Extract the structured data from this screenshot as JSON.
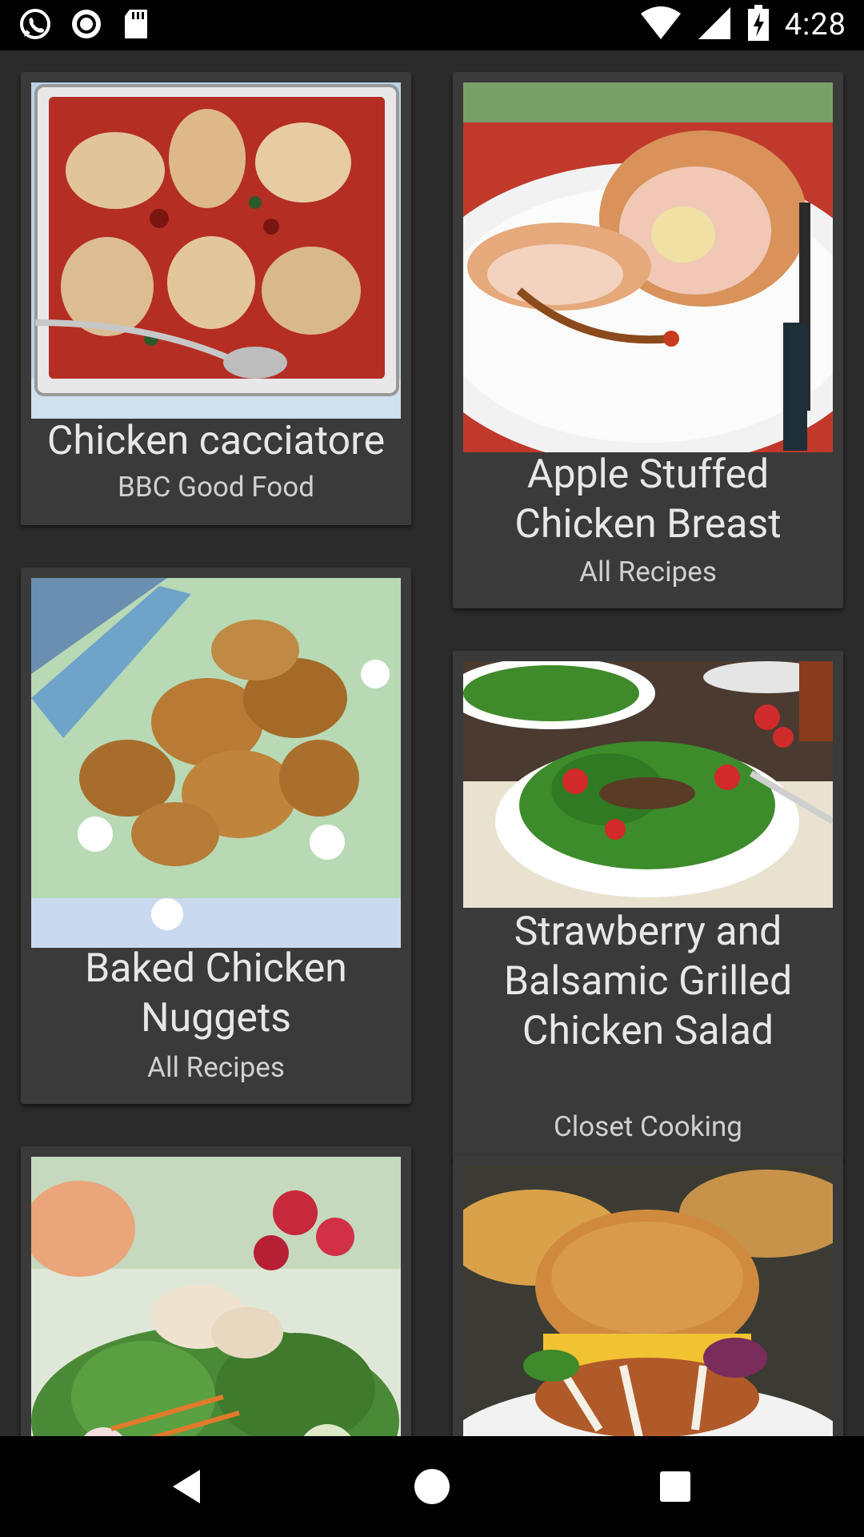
{
  "status_bar": {
    "time": "4:28",
    "icons": [
      "whatsapp-icon",
      "record-icon",
      "sd-card-icon",
      "wifi-icon",
      "signal-icon",
      "battery-charging-icon"
    ]
  },
  "recipes": [
    {
      "title": "Chicken cacciatore",
      "source": "BBC Good Food"
    },
    {
      "title": "Apple Stuffed Chicken Breast",
      "source": "All Recipes"
    },
    {
      "title": "Baked Chicken Nuggets",
      "source": "All Recipes"
    },
    {
      "title": "Strawberry and Balsamic Grilled Chicken Salad",
      "source": "Closet Cooking"
    },
    {
      "title": "",
      "source": ""
    },
    {
      "title": "",
      "source": ""
    }
  ],
  "nav_bar": {
    "icons": [
      "back-icon",
      "home-icon",
      "recents-icon"
    ]
  },
  "colors": {
    "background": "#2b2b2b",
    "card": "#3a3a3a",
    "status_bar": "#000000",
    "nav_bar": "#000000"
  }
}
